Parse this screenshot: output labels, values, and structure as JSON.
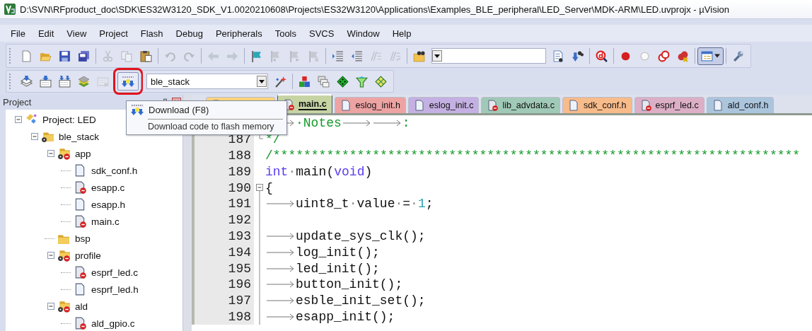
{
  "window": {
    "title": "D:\\SVN\\RFproduct_doc\\SDK\\ES32W3120_SDK_V1.0020210608\\Projects\\ES32W3120\\Applications\\Examples_BLE_peripheral\\LED_Server\\MDK-ARM\\LED.uvprojx - µVision"
  },
  "menu": [
    "File",
    "Edit",
    "View",
    "Project",
    "Flash",
    "Debug",
    "Peripherals",
    "Tools",
    "SVCS",
    "Window",
    "Help"
  ],
  "toolbar_1": [
    {
      "kind": "new",
      "disabled": false
    },
    {
      "kind": "open",
      "disabled": false
    },
    {
      "kind": "save",
      "disabled": false
    },
    {
      "kind": "save-all",
      "disabled": false
    },
    {
      "kind": "separator"
    },
    {
      "kind": "cut",
      "disabled": true
    },
    {
      "kind": "copy",
      "disabled": true
    },
    {
      "kind": "paste",
      "disabled": false
    },
    {
      "kind": "separator"
    },
    {
      "kind": "undo",
      "disabled": true
    },
    {
      "kind": "redo",
      "disabled": true
    },
    {
      "kind": "separator"
    },
    {
      "kind": "back",
      "disabled": true
    },
    {
      "kind": "forward",
      "disabled": true
    },
    {
      "kind": "separator"
    },
    {
      "kind": "flag",
      "disabled": false
    },
    {
      "kind": "flag-prev",
      "disabled": true
    },
    {
      "kind": "flag-next",
      "disabled": true
    },
    {
      "kind": "flag-clear",
      "disabled": true
    },
    {
      "kind": "separator"
    },
    {
      "kind": "indent",
      "disabled": false
    },
    {
      "kind": "unindent",
      "disabled": false
    },
    {
      "kind": "comment",
      "disabled": true
    },
    {
      "kind": "uncomment",
      "disabled": true
    },
    {
      "kind": "separator"
    },
    {
      "kind": "find-files",
      "disabled": false
    },
    {
      "kind": "combo"
    },
    {
      "kind": "find",
      "disabled": false
    },
    {
      "kind": "find-next",
      "disabled": false
    },
    {
      "kind": "separator"
    },
    {
      "kind": "debug",
      "disabled": false
    },
    {
      "kind": "separator"
    },
    {
      "kind": "breakpoint",
      "disabled": false
    },
    {
      "kind": "breakpoint-off",
      "disabled": false
    },
    {
      "kind": "breakpoints",
      "disabled": false
    },
    {
      "kind": "breakpoint-kill",
      "disabled": false
    },
    {
      "kind": "separator"
    },
    {
      "kind": "window",
      "disabled": false,
      "pressed": true
    },
    {
      "kind": "separator"
    },
    {
      "kind": "wrench",
      "disabled": false
    }
  ],
  "toolbar_2": [
    {
      "kind": "translate",
      "disabled": false
    },
    {
      "kind": "build",
      "disabled": false
    },
    {
      "kind": "rebuild",
      "disabled": false
    },
    {
      "kind": "batch",
      "disabled": false
    },
    {
      "kind": "stop",
      "disabled": true
    },
    {
      "kind": "separator"
    },
    {
      "kind": "download",
      "disabled": false,
      "highlighted": true
    },
    {
      "kind": "separator"
    },
    {
      "kind": "combo",
      "value": "ble_stack"
    },
    {
      "kind": "wand",
      "disabled": false
    },
    {
      "kind": "separator"
    },
    {
      "kind": "blocks",
      "disabled": false
    },
    {
      "kind": "windows",
      "disabled": false
    },
    {
      "kind": "diamond",
      "disabled": false
    },
    {
      "kind": "funnel",
      "disabled": false
    },
    {
      "kind": "books",
      "disabled": false
    }
  ],
  "project_panel": {
    "title": "Project",
    "tree": [
      {
        "label": "Project: LED",
        "kind": "project",
        "expanded": true,
        "children": [
          {
            "label": "ble_stack",
            "kind": "folder-gear",
            "expanded": true,
            "children": [
              {
                "label": "app",
                "kind": "folder-gear-minus",
                "expanded": true,
                "children": [
                  {
                    "label": "sdk_conf.h",
                    "kind": "file"
                  },
                  {
                    "label": "esapp.c",
                    "kind": "file-minus"
                  },
                  {
                    "label": "esapp.h",
                    "kind": "file"
                  },
                  {
                    "label": "main.c",
                    "kind": "file-minus"
                  }
                ]
              },
              {
                "label": "bsp",
                "kind": "folder"
              },
              {
                "label": "profile",
                "kind": "folder-gear-minus",
                "expanded": true,
                "children": [
                  {
                    "label": "esprf_led.c",
                    "kind": "file-minus"
                  },
                  {
                    "label": "esprf_led.h",
                    "kind": "file"
                  }
                ]
              },
              {
                "label": "ald",
                "kind": "folder-gear-minus",
                "expanded": true,
                "children": [
                  {
                    "label": "ald_gpio.c",
                    "kind": "file-minus"
                  }
                ]
              }
            ]
          }
        ]
      }
    ]
  },
  "tabs": [
    {
      "kind": "file",
      "color": "#fcd47c",
      "selected": false
    },
    {
      "label": "main.c",
      "kind": "file-minus",
      "color": "#c6d4a4",
      "selected": true
    },
    {
      "label": "eslog_init.h",
      "kind": "file",
      "color": "#eea3a3",
      "selected": false
    },
    {
      "label": "eslog_init.c",
      "kind": "file",
      "color": "#c4b0e2",
      "selected": false
    },
    {
      "label": "lib_advdata.c",
      "kind": "file-minus",
      "color": "#a0c9b7",
      "selected": false
    },
    {
      "label": "sdk_conf.h",
      "kind": "file",
      "color": "#f8bb8a",
      "selected": false
    },
    {
      "label": "esprf_led.c",
      "kind": "file-minus",
      "color": "#dcafc6",
      "selected": false
    },
    {
      "label": "ald_conf.h",
      "kind": "file",
      "color": "#abc5dd",
      "selected": false
    }
  ],
  "tooltip": {
    "title": "Download (F8)",
    "description": "Download code to flash memory"
  },
  "code": [
    {
      "segments": [
        {
          "kind": "tab"
        },
        {
          "kind": "comment",
          "text": "·Notes"
        },
        {
          "kind": "tab"
        },
        {
          "kind": "tab"
        },
        {
          "kind": "comment",
          "text": ":"
        }
      ]
    },
    {
      "number": "187",
      "kind": "fold-end",
      "segments": [
        {
          "kind": "comment",
          "text": "*/"
        }
      ]
    },
    {
      "number": "188",
      "segments": [
        {
          "kind": "comment",
          "text": "/*********************************************************************"
        }
      ]
    },
    {
      "number": "189",
      "segments": [
        {
          "kind": "keyword",
          "text": "int"
        },
        {
          "kind": "space",
          "text": "·"
        },
        {
          "kind": "plain",
          "text": "main("
        },
        {
          "kind": "keyword",
          "text": "void"
        },
        {
          "kind": "plain",
          "text": ")"
        }
      ]
    },
    {
      "number": "190",
      "kind": "fold-start",
      "segments": [
        {
          "kind": "plain",
          "text": "{"
        }
      ]
    },
    {
      "number": "191",
      "kind": "fold-body",
      "segments": [
        {
          "kind": "tab"
        },
        {
          "kind": "plain",
          "text": "uint8_t"
        },
        {
          "kind": "space",
          "text": "·"
        },
        {
          "kind": "plain",
          "text": "value"
        },
        {
          "kind": "space",
          "text": "·"
        },
        {
          "kind": "plain",
          "text": "="
        },
        {
          "kind": "space",
          "text": "·"
        },
        {
          "kind": "number",
          "text": "1"
        },
        {
          "kind": "plain",
          "text": ";"
        }
      ]
    },
    {
      "number": "192",
      "kind": "fold-body"
    },
    {
      "number": "193",
      "kind": "fold-body",
      "segments": [
        {
          "kind": "tab"
        },
        {
          "kind": "plain",
          "text": "update_sys_clk();"
        }
      ]
    },
    {
      "number": "194",
      "kind": "fold-body",
      "segments": [
        {
          "kind": "tab"
        },
        {
          "kind": "plain",
          "text": "log_init();"
        }
      ]
    },
    {
      "number": "195",
      "kind": "fold-body",
      "segments": [
        {
          "kind": "tab"
        },
        {
          "kind": "plain",
          "text": "led_init();"
        }
      ]
    },
    {
      "number": "196",
      "kind": "fold-body",
      "segments": [
        {
          "kind": "tab"
        },
        {
          "kind": "plain",
          "text": "button_init();"
        }
      ]
    },
    {
      "number": "197",
      "kind": "fold-body",
      "segments": [
        {
          "kind": "tab"
        },
        {
          "kind": "plain",
          "text": "esble_init_set();"
        }
      ]
    },
    {
      "number": "198",
      "kind": "fold-body",
      "segments": [
        {
          "kind": "tab"
        },
        {
          "kind": "plain",
          "text": "esapp_init();"
        }
      ]
    }
  ]
}
